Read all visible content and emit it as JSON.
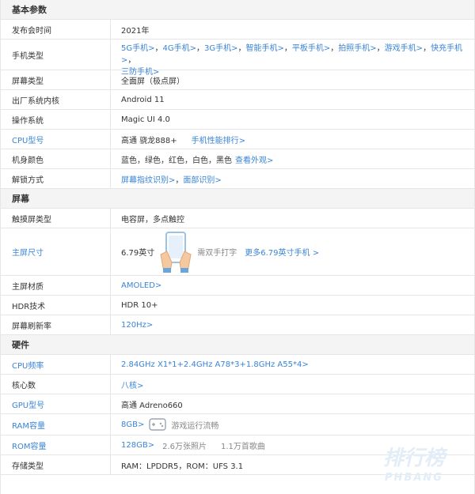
{
  "sections": {
    "basic": "基本参数",
    "screen": "屏幕",
    "hardware": "硬件"
  },
  "rows": {
    "release": {
      "label": "发布会时间",
      "value": "2021年"
    },
    "phone_type": {
      "label": "手机类型",
      "links": [
        "5G手机>",
        "4G手机>",
        "3G手机>",
        "智能手机>",
        "平板手机>",
        "拍照手机>",
        "游戏手机>",
        "快充手机>",
        "三防手机>"
      ]
    },
    "screen_type": {
      "label": "屏幕类型",
      "value": "全面屏（极点屏）"
    },
    "kernel": {
      "label": "出厂系统内核",
      "value": "Android 11"
    },
    "os": {
      "label": "操作系统",
      "value": "Magic UI 4.0"
    },
    "cpu": {
      "label": "CPU型号",
      "value": "高通 骁龙888+",
      "link": "手机性能排行>"
    },
    "color": {
      "label": "机身颜色",
      "value": "蓝色，绿色，红色，白色，黑色",
      "link": "查看外观>"
    },
    "unlock": {
      "label": "解锁方式",
      "links": [
        "屏幕指纹识别>",
        "面部识别>"
      ]
    },
    "touch": {
      "label": "触摸屏类型",
      "value": "电容屏，多点触控"
    },
    "main_size": {
      "label": "主屏尺寸",
      "value": "6.79英寸",
      "hint": "需双手打字",
      "link": "更多6.79英寸手机 >"
    },
    "material": {
      "label": "主屏材质",
      "link": "AMOLED>"
    },
    "hdr": {
      "label": "HDR技术",
      "value": "HDR 10+"
    },
    "refresh": {
      "label": "屏幕刷新率",
      "link": "120Hz>"
    },
    "cpu_freq": {
      "label": "CPU频率",
      "link": "2.84GHz X1*1+2.4GHz A78*3+1.8GHz A55*4>"
    },
    "cores": {
      "label": "核心数",
      "link": "八核>"
    },
    "gpu": {
      "label": "GPU型号",
      "value": "高通 Adreno660"
    },
    "ram": {
      "label": "RAM容量",
      "link": "8GB>",
      "hint": "游戏运行流畅"
    },
    "rom": {
      "label": "ROM容量",
      "link": "128GB>",
      "hint1": "2.6万张照片",
      "hint2": "1.1万首歌曲"
    },
    "storage": {
      "label": "存储类型",
      "value": "RAM：LPDDR5，ROM：UFS 3.1"
    }
  },
  "watermark": {
    "line1": "排行榜",
    "line2": "PHBANG"
  },
  "colors": {
    "link": "#3a84d6",
    "section_bg": "#f4f4f4",
    "border": "#e6e6e6"
  }
}
